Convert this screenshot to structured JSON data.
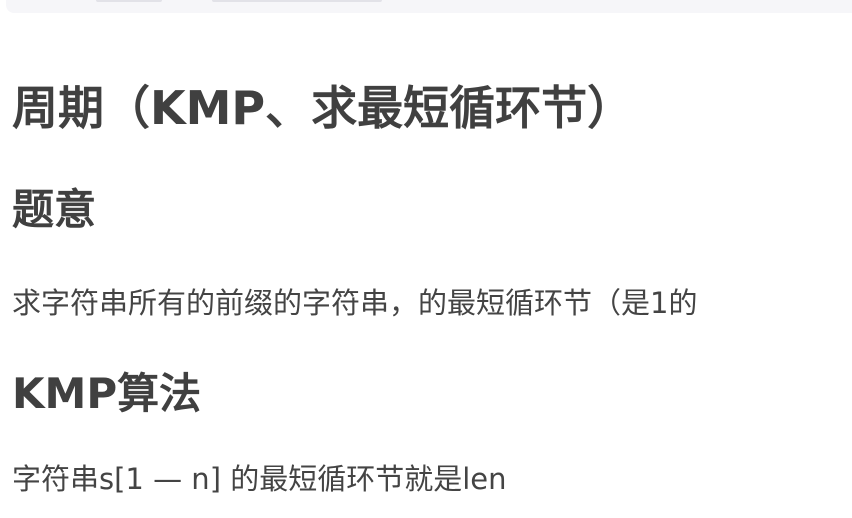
{
  "title": "周期（KMP、求最短循环节）",
  "sections": [
    {
      "heading": "题意",
      "text": "求字符串所有的前缀的字符串，的最短循环节（是1的"
    },
    {
      "heading": "KMP算法",
      "text": "字符串s[1 — n] 的最短循环节就是len"
    }
  ]
}
